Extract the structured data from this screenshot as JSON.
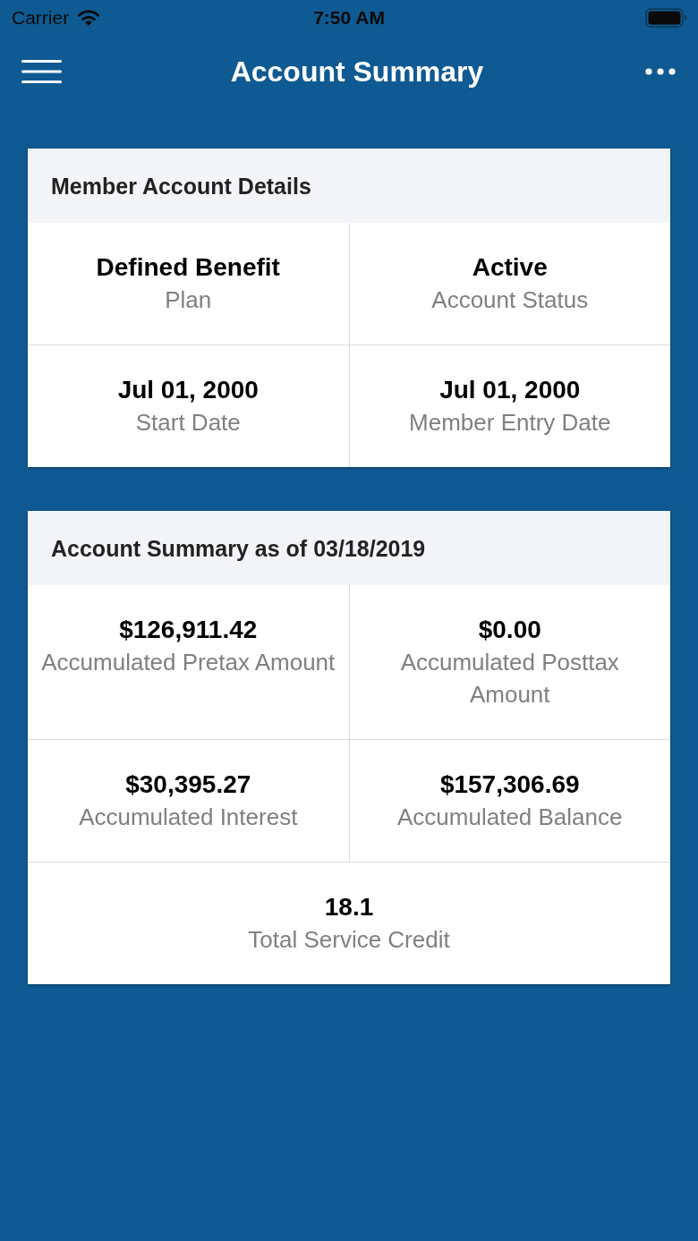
{
  "status_bar": {
    "carrier": "Carrier",
    "time": "7:50 AM"
  },
  "nav_bar": {
    "title": "Account Summary"
  },
  "cards": [
    {
      "title": "Member Account Details",
      "rows": [
        {
          "cells": [
            {
              "value": "Defined Benefit",
              "label": "Plan"
            },
            {
              "value": "Active",
              "label": "Account Status"
            }
          ]
        },
        {
          "cells": [
            {
              "value": "Jul 01, 2000",
              "label": "Start Date"
            },
            {
              "value": "Jul 01, 2000",
              "label": "Member Entry Date"
            }
          ]
        }
      ]
    },
    {
      "title": "Account Summary as of 03/18/2019",
      "rows": [
        {
          "cells": [
            {
              "value": "$126,911.42",
              "label": "Accumulated Pretax Amount"
            },
            {
              "value": "$0.00",
              "label": "Accumulated Posttax Amount"
            }
          ]
        },
        {
          "cells": [
            {
              "value": "$30,395.27",
              "label": "Accumulated Interest"
            },
            {
              "value": "$157,306.69",
              "label": "Accumulated Balance"
            }
          ]
        },
        {
          "cells": [
            {
              "value": "18.1",
              "label": "Total Service Credit"
            }
          ]
        }
      ]
    }
  ]
}
